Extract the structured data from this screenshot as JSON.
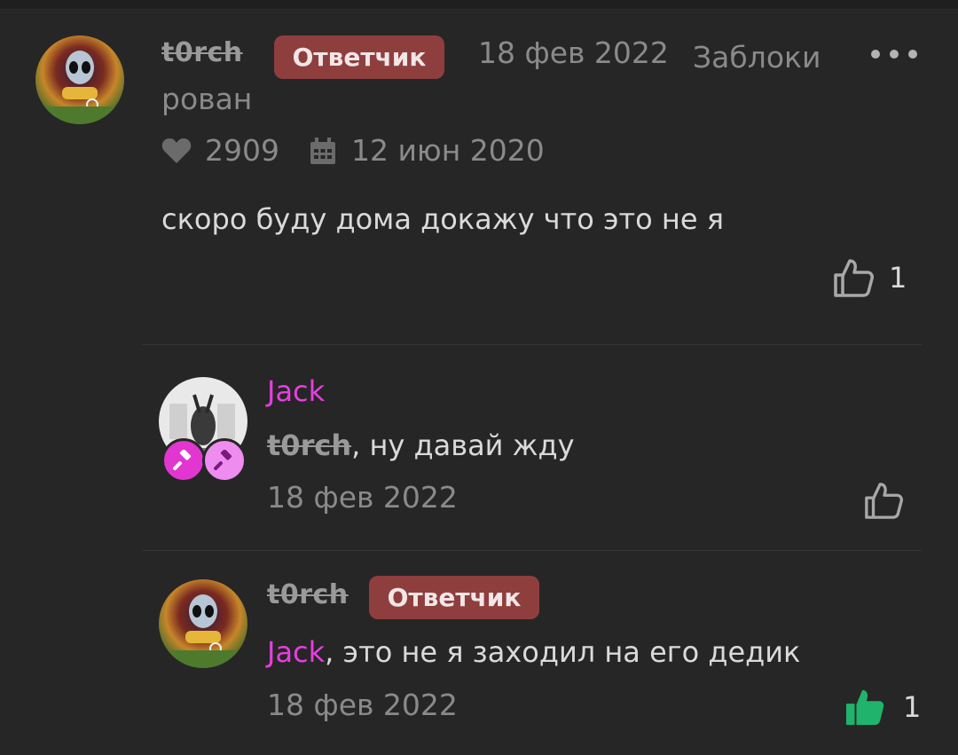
{
  "colors": {
    "background": "#262626",
    "badge": "#8f3e3e",
    "mention": "#e83ee0",
    "liked": "#1fb36b",
    "muted_text": "#8a8a8a"
  },
  "comment1": {
    "author": "t0rch",
    "badge": "Ответчик",
    "date": "18 фев 2022",
    "status_part1": "Заблоки",
    "status_part2": "рован",
    "likes_received": "2909",
    "joined": "12 июн 2020",
    "text": "скоро буду дома докажу что это не я",
    "like_count": "1",
    "icons": [
      "heart-icon",
      "calendar-icon",
      "thumbs-up-icon",
      "more-options-icon"
    ]
  },
  "reply1": {
    "author": "Jack",
    "mention": "t0rch",
    "text_rest": ", ну давай жду",
    "date": "18 фев 2022",
    "icons": [
      "gavel-icon",
      "gavel-icon",
      "thumbs-up-icon"
    ]
  },
  "reply2": {
    "author": "t0rch",
    "badge": "Ответчик",
    "mention": "Jack",
    "text_rest": ", это не я заходил на его дедик",
    "date": "18 фев 2022",
    "like_count": "1",
    "liked": true,
    "icons": [
      "thumbs-up-filled-icon"
    ]
  }
}
